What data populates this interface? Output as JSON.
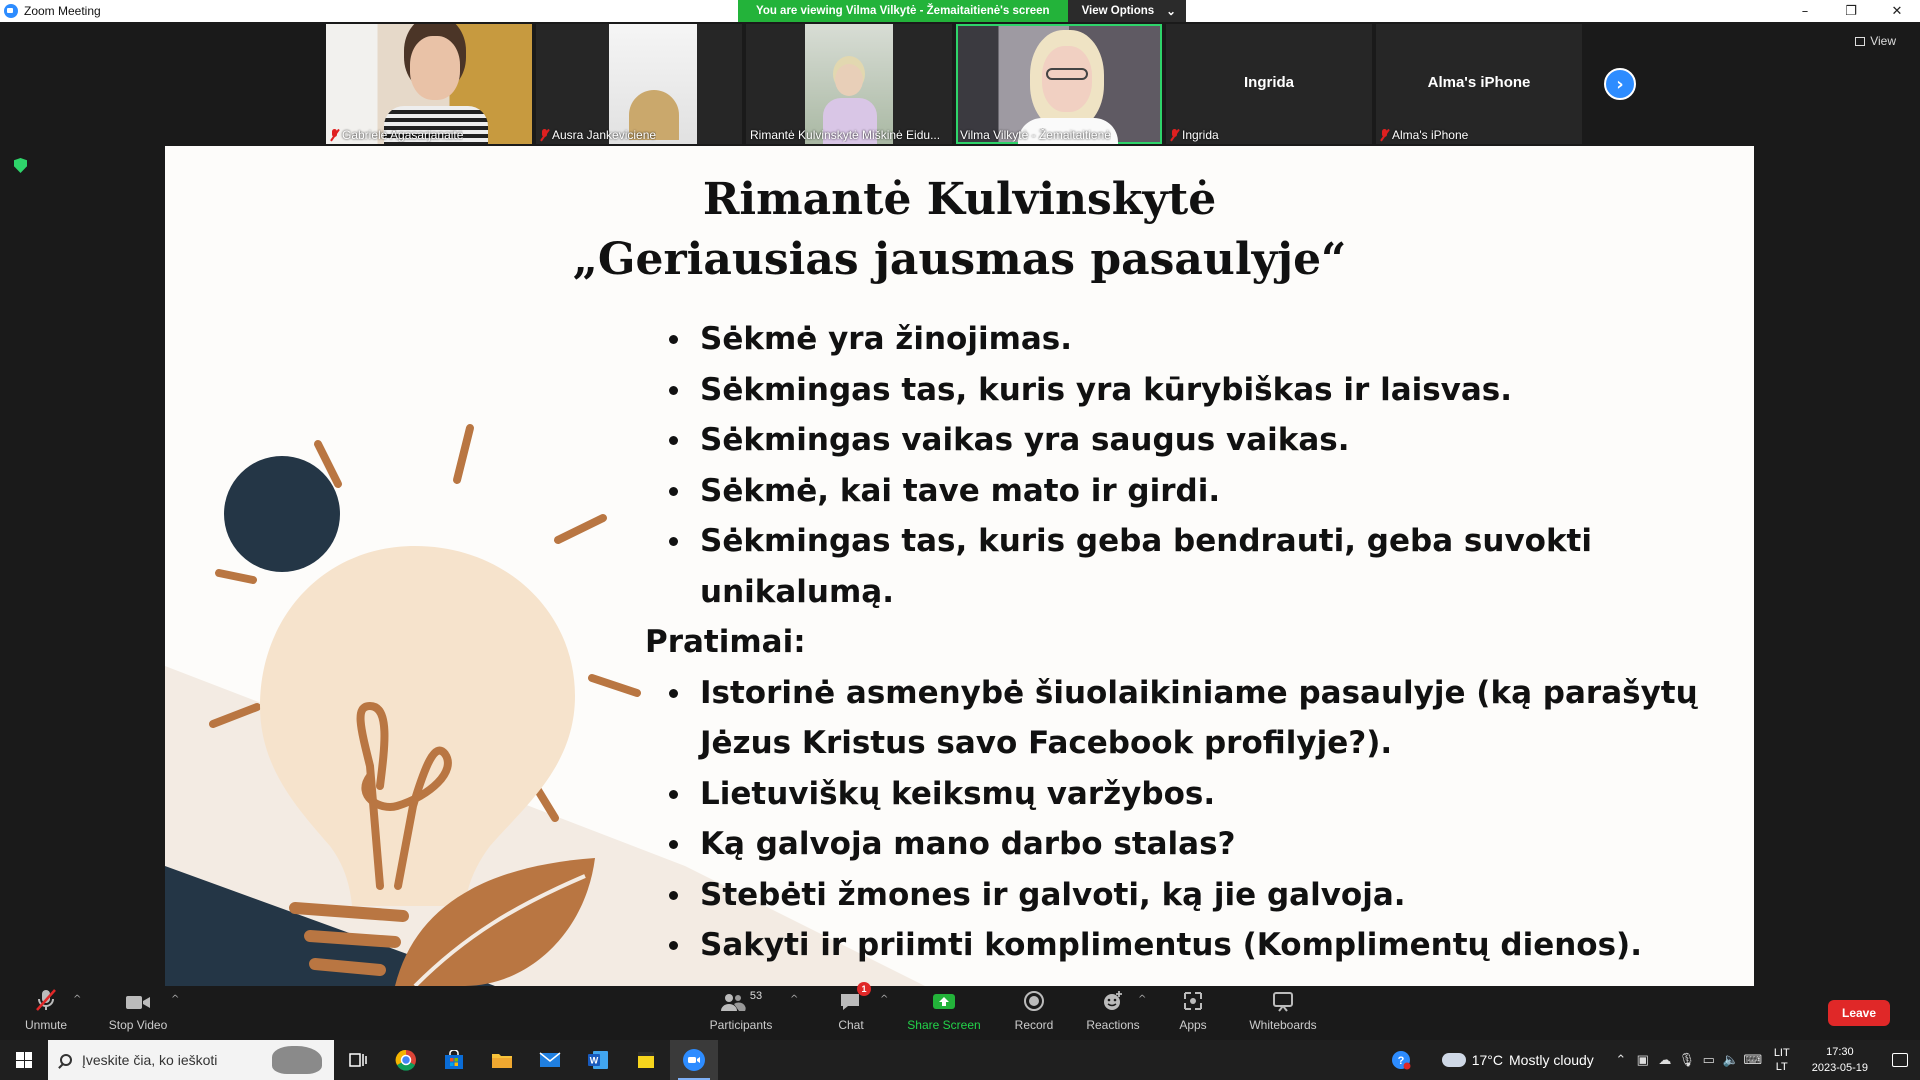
{
  "window": {
    "title": "Zoom Meeting",
    "controls": [
      "–",
      "❐",
      "✕"
    ]
  },
  "share_banner": {
    "message": "You are viewing Vilma Vilkytė - Žemaitaitienė's screen",
    "view_options": "View Options"
  },
  "participants_strip": [
    {
      "name": "Gabrielė Agasarjanaitė",
      "muted": true
    },
    {
      "name": "Ausra Jankeviciene",
      "muted": true
    },
    {
      "name": "Rimantė Kulvinskytė Miškinė Eidu...",
      "muted": false
    },
    {
      "name": "Vilma Vilkytė - Žemaitaitienė",
      "muted": false,
      "active": true
    },
    {
      "name": "Ingrida",
      "muted": true,
      "display_name": "Ingrida"
    },
    {
      "name": "Alma's iPhone",
      "muted": true,
      "display_name": "Alma's iPhone"
    }
  ],
  "view_button": "View",
  "slide": {
    "title_line1": "Rimantė Kulvinskytė",
    "title_line2": "„Geriausias jausmas pasaulyje“",
    "bullets_1": [
      "Sėkmė yra žinojimas.",
      "Sėkmingas tas, kuris yra kūrybiškas ir laisvas.",
      "Sėkmingas vaikas yra saugus vaikas.",
      "Sėkmė, kai tave mato ir girdi.",
      "Sėkmingas tas, kuris geba bendrauti, geba suvokti unikalumą."
    ],
    "heading": "Pratimai:",
    "bullets_2": [
      "Istorinė asmenybė šiuolaikiniame pasaulyje (ką parašytų Jėzus Kristus savo Facebook profilyje?).",
      "Lietuviškų keiksmų varžybos.",
      "Ką galvoja mano darbo stalas?",
      "Stebėti žmones ir galvoti, ką jie galvoja.",
      "Sakyti ir priimti komplimentus (Komplimentų dienos)."
    ],
    "colors": {
      "dark_navy": "#243646",
      "bulb_cream": "#f6e3cc",
      "copper": "#b97642",
      "bg": "#fdfcfa"
    }
  },
  "toolbar": {
    "unmute": "Unmute",
    "stop_video": "Stop Video",
    "participants": "Participants",
    "participants_count": "53",
    "chat": "Chat",
    "chat_badge": "1",
    "share_screen": "Share Screen",
    "record": "Record",
    "reactions": "Reactions",
    "apps": "Apps",
    "whiteboards": "Whiteboards",
    "leave": "Leave"
  },
  "taskbar": {
    "search_placeholder": "Įveskite čia, ko ieškoti",
    "apps": [
      "task-view-icon",
      "chrome-icon",
      "store-icon",
      "file-explorer-icon",
      "mail-icon",
      "word-icon",
      "sticky-notes-icon",
      "zoom-icon"
    ],
    "weather_temp": "17°C",
    "weather_text": "Mostly cloudy",
    "lang_top": "LIT",
    "lang_bottom": "LT",
    "time": "17:30",
    "date": "2023-05-19"
  }
}
